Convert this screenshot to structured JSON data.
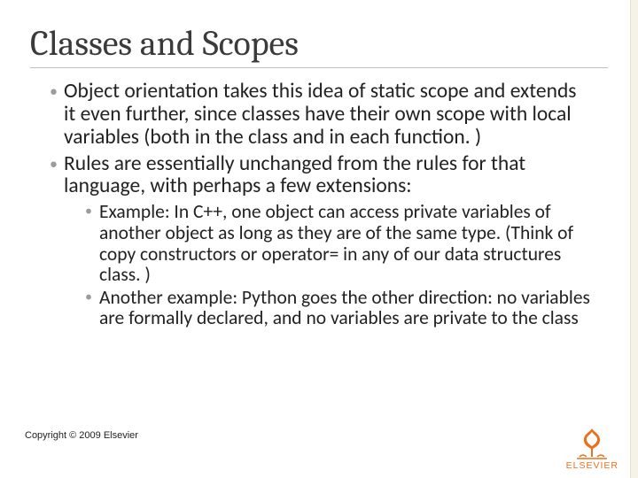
{
  "title": "Classes and Scopes",
  "bullets": {
    "b1": "Object orientation takes this idea of static scope and extends it even further, since classes have their own scope with local variables (both in the class and in each function. )",
    "b2": "Rules are essentially unchanged from the rules for that language, with perhaps a few extensions:",
    "sub1": "Example: In C++, one object can access private variables of another object as long as they are of the same type.  (Think of copy constructors or operator= in any of our data structures class. )",
    "sub2": "Another example: Python goes the other direction: no variables are formally declared, and no variables are private to the class"
  },
  "copyright": "Copyright © 2009 Elsevier",
  "brand": {
    "name": "ELSEVIER"
  },
  "colors": {
    "accent": "#e9711c",
    "title": "#3b3b3b",
    "bullet_marker": "#9c9c9c"
  }
}
